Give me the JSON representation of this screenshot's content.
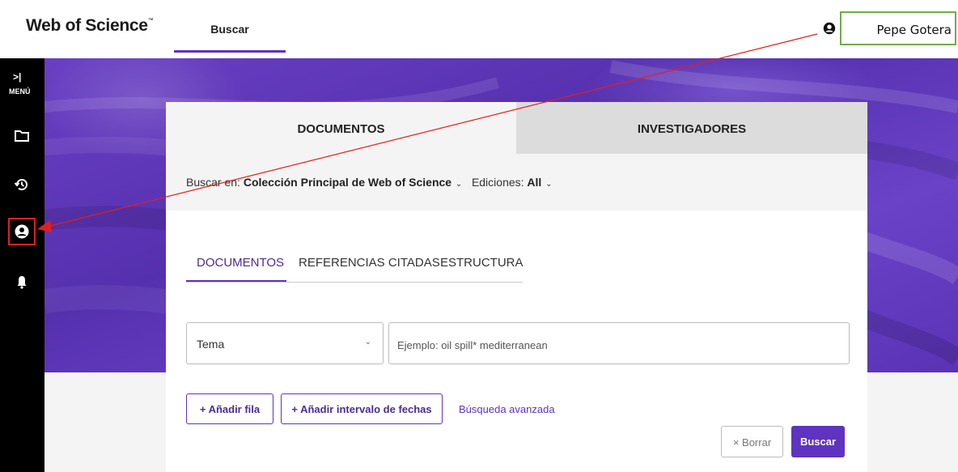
{
  "header": {
    "logo_text": "Web of Science",
    "logo_mark": "™",
    "nav_search": "Buscar",
    "username": "Pepe Gotera"
  },
  "sidebar": {
    "menu_chevron": ">|",
    "menu_label": "MENÚ",
    "items": [
      "folder-icon",
      "history-icon",
      "user-profile-icon",
      "bell-icon"
    ],
    "highlight_color": "#e0201f"
  },
  "card": {
    "tabs": [
      "DOCUMENTOS",
      "INVESTIGADORES"
    ],
    "search_in": {
      "label": "Buscar en:",
      "collection": "Colección Principal de Web of Science",
      "editions_label": "Ediciones:",
      "editions_value": "All"
    },
    "sub_tabs": [
      "DOCUMENTOS",
      "REFERENCIAS CITADAS",
      "ESTRUCTURA"
    ],
    "field_select": "Tema",
    "search_placeholder": "Ejemplo: oil spill* mediterranean",
    "add_row": "+ Añadir fila",
    "add_date_range": "+ Añadir intervalo de fechas",
    "advanced_search": "Búsqueda avanzada",
    "clear": "× Borrar",
    "search": "Buscar"
  },
  "colors": {
    "accent": "#5e33bf",
    "hero": "#5a33b5",
    "annotation_box_border": "#70ad47",
    "annotation_arrow": "#e0201f"
  }
}
